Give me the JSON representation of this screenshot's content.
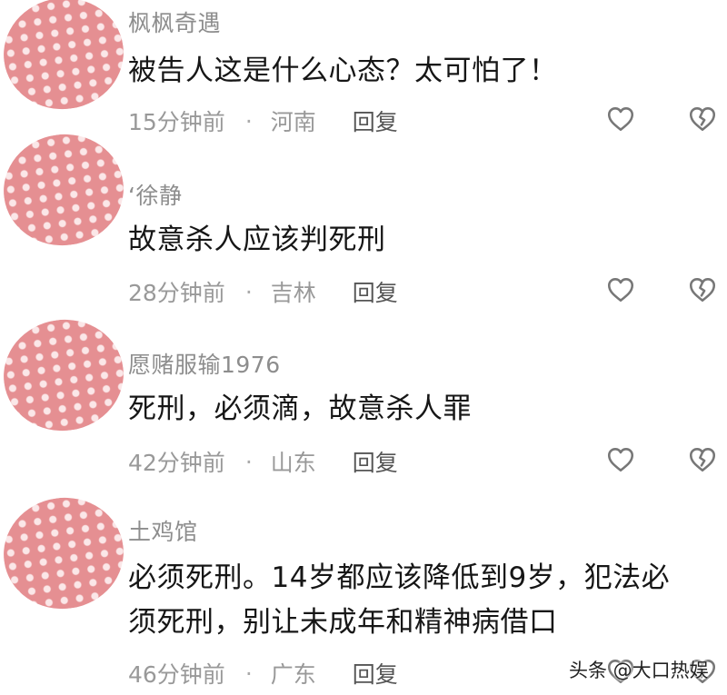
{
  "comments": [
    {
      "username": "枫枫奇遇",
      "lines": [
        "被告人这是什么心态？太可怕了！"
      ],
      "time": "15分钟前",
      "location": "河南",
      "reply_label": "回复",
      "like_icon": "heart-outline-icon",
      "dislike_icon": "broken-heart-icon"
    },
    {
      "username": "‘徐静",
      "lines": [
        "故意杀人应该判死刑"
      ],
      "time": "28分钟前",
      "location": "吉林",
      "reply_label": "回复",
      "like_icon": "heart-outline-icon",
      "dislike_icon": "broken-heart-icon"
    },
    {
      "username": "愿赌服输1976",
      "lines": [
        "死刑，必须滴，故意杀人罪"
      ],
      "time": "42分钟前",
      "location": "山东",
      "reply_label": "回复",
      "like_icon": "heart-outline-icon",
      "dislike_icon": "broken-heart-icon"
    },
    {
      "username": "土鸡馆",
      "lines": [
        "必须死刑。14岁都应该降低到9岁，犯法必",
        "须死刑，别让未成年和精神病借口"
      ],
      "time": "46分钟前",
      "location": "广东",
      "reply_label": "回复",
      "like_icon": "heart-outline-icon",
      "dislike_icon": "broken-heart-icon"
    }
  ],
  "meta_separator": "·",
  "watermark": "头条 @大口热娱",
  "colors": {
    "avatar": "#e58f92",
    "username": "#8d8d8d",
    "content": "#161616",
    "meta": "#999999",
    "reply": "#555555",
    "icon": "#777777"
  }
}
